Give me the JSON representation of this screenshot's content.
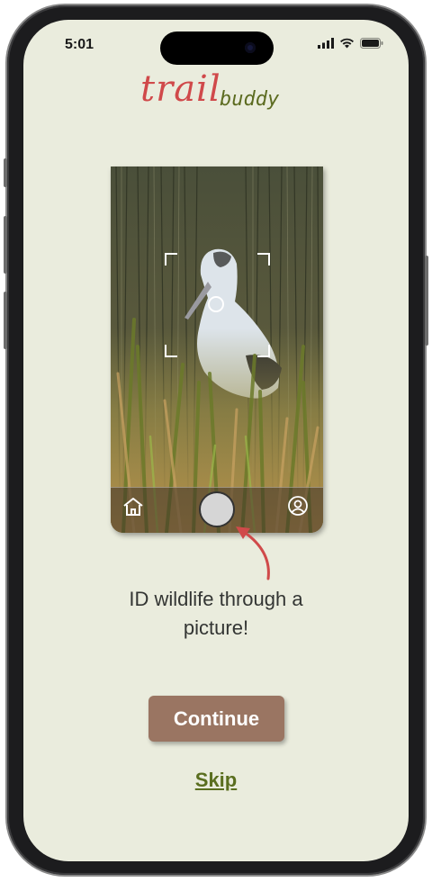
{
  "status_bar": {
    "time": "5:01",
    "icons": [
      "signal-icon",
      "wifi-icon",
      "battery-icon"
    ]
  },
  "logo": {
    "part1": "trail",
    "part2": "buddy"
  },
  "camera_preview": {
    "nav_icons": [
      "home-icon",
      "shutter-button",
      "profile-icon"
    ]
  },
  "caption": {
    "line1": "ID wildlife through a",
    "line2": "picture!"
  },
  "buttons": {
    "continue_label": "Continue",
    "skip_label": "Skip"
  },
  "colors": {
    "background": "#eaecdd",
    "logo_trail": "#d0494a",
    "logo_buddy": "#5c6b20",
    "continue_button": "#9a7562",
    "skip_link": "#5a6e1f",
    "arrow": "#d04a4a"
  }
}
